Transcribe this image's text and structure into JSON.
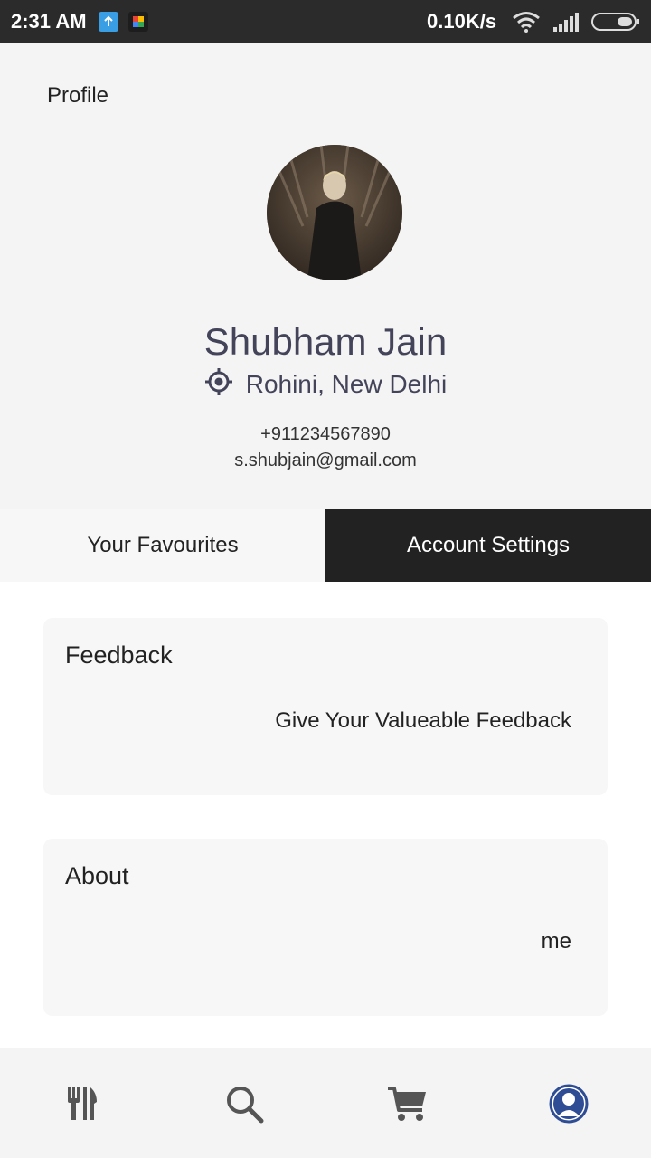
{
  "status_bar": {
    "time": "2:31 AM",
    "network_speed": "0.10K/s",
    "icons": [
      "upload-notification-icon",
      "photos-notification-icon",
      "wifi-icon",
      "signal-icon",
      "battery-icon"
    ]
  },
  "profile": {
    "page_title": "Profile",
    "name": "Shubham Jain",
    "location": "Rohini, New Delhi",
    "phone": "+911234567890",
    "email": "s.shubjain@gmail.com"
  },
  "tabs": [
    {
      "label": "Your Favourites",
      "active": false
    },
    {
      "label": "Account Settings",
      "active": true
    }
  ],
  "cards": [
    {
      "title": "Feedback",
      "subtitle": "Give Your Valueable Feedback"
    },
    {
      "title": "About",
      "subtitle": "me"
    }
  ],
  "bottom_nav": {
    "items": [
      "restaurant-icon",
      "search-icon",
      "cart-icon",
      "profile-icon"
    ],
    "active": "profile-icon",
    "active_color": "#2e4d94",
    "inactive_color": "#555555"
  },
  "colors": {
    "name_text": "#43435a",
    "active_tab_bg": "#222222"
  }
}
